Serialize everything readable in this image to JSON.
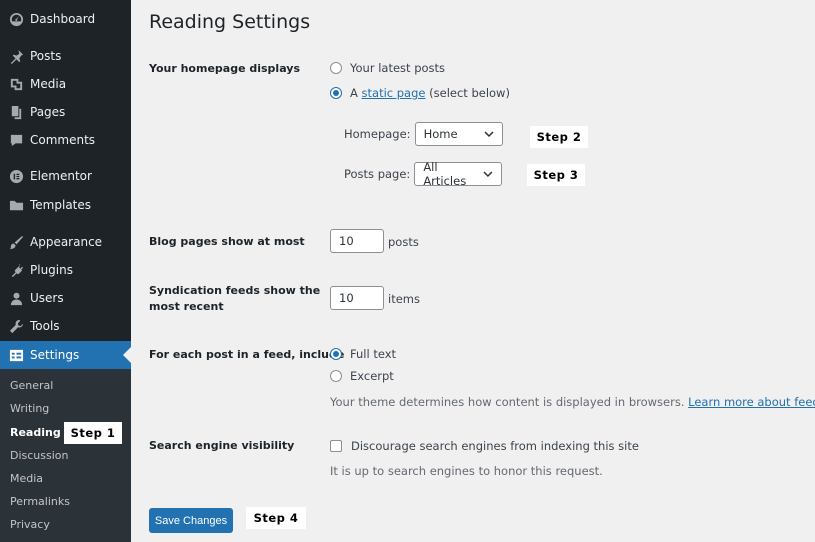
{
  "sidebar": {
    "items": [
      {
        "label": "Dashboard",
        "icon": "dashboard-icon"
      },
      {
        "label": "Posts",
        "icon": "pin-icon"
      },
      {
        "label": "Media",
        "icon": "media-icon"
      },
      {
        "label": "Pages",
        "icon": "pages-icon"
      },
      {
        "label": "Comments",
        "icon": "comment-icon"
      },
      {
        "label": "Elementor",
        "icon": "elementor-icon"
      },
      {
        "label": "Templates",
        "icon": "folder-icon"
      },
      {
        "label": "Appearance",
        "icon": "brush-icon"
      },
      {
        "label": "Plugins",
        "icon": "plug-icon"
      },
      {
        "label": "Users",
        "icon": "user-icon"
      },
      {
        "label": "Tools",
        "icon": "wrench-icon"
      },
      {
        "label": "Settings",
        "icon": "settings-icon"
      }
    ],
    "submenu": [
      "General",
      "Writing",
      "Reading",
      "Discussion",
      "Media",
      "Permalinks",
      "Privacy"
    ]
  },
  "page": {
    "title": "Reading Settings",
    "homepage_displays": {
      "label": "Your homepage displays",
      "option_latest": "Your latest posts",
      "option_static_prefix": "A ",
      "option_static_link": "static page",
      "option_static_suffix": " (select below)",
      "homepage_label": "Homepage:",
      "homepage_value": "Home",
      "posts_page_label": "Posts page:",
      "posts_page_value": "All Articles"
    },
    "blog_pages": {
      "label": "Blog pages show at most",
      "value": "10",
      "unit": "posts"
    },
    "syndication": {
      "label_line1": "Syndication feeds show the",
      "label_line2": "most recent",
      "value": "10",
      "unit": "items"
    },
    "feed_include": {
      "label": "For each post in a feed, include",
      "option_full": "Full text",
      "option_excerpt": "Excerpt",
      "desc_prefix": "Your theme determines how content is displayed in browsers. ",
      "desc_link": "Learn more about feeds",
      "desc_suffix": "."
    },
    "search_visibility": {
      "label": "Search engine visibility",
      "checkbox_label": "Discourage search engines from indexing this site",
      "desc": "It is up to search engines to honor this request."
    },
    "save_label": "Save Changes"
  },
  "steps": {
    "step1": "Step 1",
    "step2": "Step 2",
    "step3": "Step 3",
    "step4": "Step 4"
  },
  "colors": {
    "accent": "#2271b1",
    "sidebar_bg": "#1d2327",
    "submenu_bg": "#2c3338",
    "page_bg": "#f0f0f1"
  }
}
